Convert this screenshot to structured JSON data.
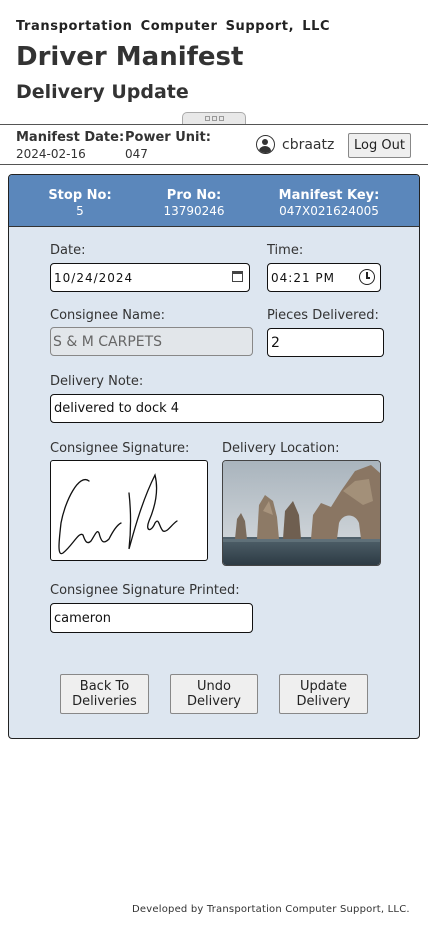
{
  "header": {
    "company": "Transportation Computer Support, LLC",
    "title": "Driver Manifest",
    "subtitle": "Delivery Update"
  },
  "manifest_info": {
    "date_label": "Manifest Date:",
    "date_value": "2024-02-16",
    "power_unit_label": "Power Unit:",
    "power_unit_value": "047",
    "username": "cbraatz",
    "logout_label": "Log Out"
  },
  "stop_header": {
    "stop_label": "Stop No:",
    "stop_value": "5",
    "pro_label": "Pro No:",
    "pro_value": "13790246",
    "key_label": "Manifest Key:",
    "key_value": "047X021624005"
  },
  "form": {
    "date_label": "Date:",
    "date_value": "10/24/2024",
    "time_label": "Time:",
    "time_value": "04:21 PM",
    "consignee_label": "Consignee Name:",
    "consignee_value": "S & M CARPETS",
    "pieces_label": "Pieces Delivered:",
    "pieces_value": "2",
    "note_label": "Delivery Note:",
    "note_value": "delivered to dock 4",
    "signature_label": "Consignee Signature:",
    "location_label": "Delivery Location:",
    "printed_label": "Consignee Signature Printed:",
    "printed_value": "cameron"
  },
  "actions": {
    "back_label": "Back To Deliveries",
    "undo_label": "Undo Delivery",
    "update_label": "Update Delivery"
  },
  "footer": {
    "text": "Developed by Transportation Computer Support, LLC."
  },
  "colors": {
    "card_header": "#5b87bb",
    "card_body": "#dde6f0"
  }
}
